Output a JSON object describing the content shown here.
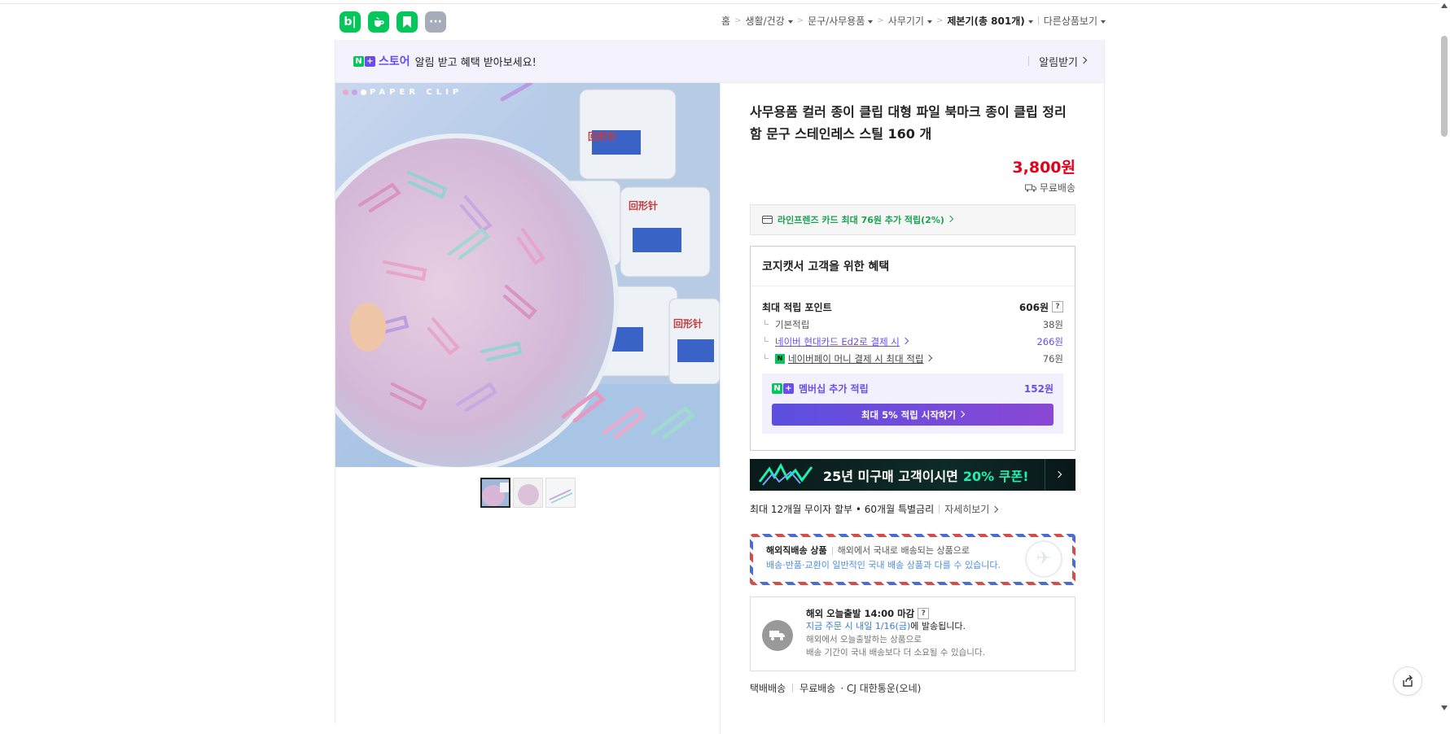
{
  "header": {
    "apps": [
      {
        "name": "blog-app",
        "label": "b|"
      },
      {
        "name": "cafe-app",
        "label": ""
      },
      {
        "name": "bookmark-app",
        "label": ""
      },
      {
        "name": "more-apps",
        "label": "···"
      }
    ],
    "breadcrumb": {
      "home": "홈",
      "cat1": "생활/건강",
      "cat2": "문구/사무용품",
      "cat3": "사무기기",
      "cat4": "제본기(총 801개)",
      "other": "다른상품보기"
    }
  },
  "notification": {
    "store_label": "스토어",
    "message": "알림 받고 혜택 받아보세요!",
    "action": "알림받기"
  },
  "gallery": {
    "brand_text": "PAPER CLIP",
    "thumbnail_count": 3
  },
  "product": {
    "title": "사무용품 컬러 종이 클립 대형 파일 북마크 종이 클립 정리함 문구 스테인레스 스틸 160 개",
    "price": "3,800원",
    "shipping": "무료배송",
    "card_promo": "라인프렌즈 카드 최대 76원 추가 적립(2%)"
  },
  "benefits": {
    "heading": "코지캣서 고객을 위한 혜택",
    "max_points_label": "최대 적립 포인트",
    "max_points_value": "606원",
    "rows": [
      {
        "label": "기본적립",
        "value": "38원"
      },
      {
        "label": "네이버 현대카드 Ed2로 결제 시",
        "value": "266원"
      },
      {
        "label": "네이버페이 머니 결제 시 최대 적립",
        "value": "76원"
      }
    ],
    "membership_label": "멤버십 추가 적립",
    "membership_value": "152원",
    "membership_button": "최대 5% 적립 시작하기"
  },
  "banner": {
    "text_prefix": "25년 미구매 고객이시면",
    "text_highlight": "20% 쿠폰!"
  },
  "installment": {
    "text": "최대 12개월 무이자 할부 • 60개월 특별금리",
    "more": "자세히보기"
  },
  "overseas": {
    "title": "해외직배송 상품",
    "desc": "해외에서 국내로 배송되는 상품으로",
    "note": "배송·반품·교환이 일반적인 국내 배송 상품과 다를 수 있습니다."
  },
  "delivery": {
    "title": "해외 오늘출발 14:00 마감",
    "line2_prefix": "지금 주문 시 내일 1/16(금)",
    "line2_suffix": "에 발송됩니다.",
    "line3": "해외에서 오늘출발하는 상품으로",
    "line4": "배송 기간이 국내 배송보다 더 소요될 수 있습니다."
  },
  "shipping_row": {
    "type": "택배배송",
    "fee": "무료배송",
    "carrier": "· CJ 대한통운(오네)"
  },
  "colors": {
    "naver_green": "#03c75a",
    "price_red": "#e3001b",
    "purple": "#6b4cf0"
  }
}
